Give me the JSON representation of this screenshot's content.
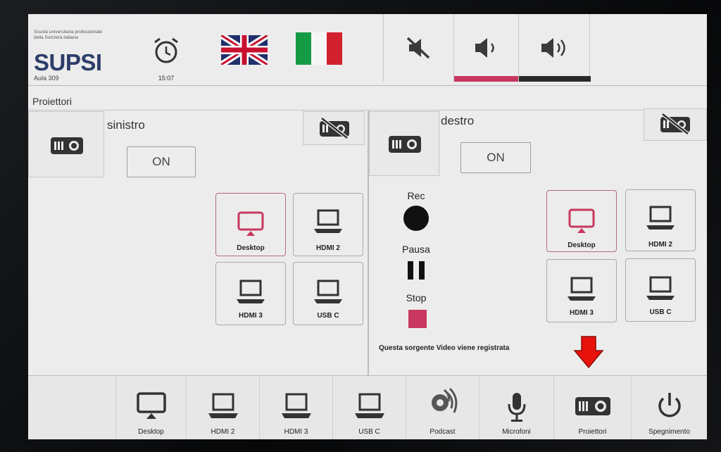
{
  "header": {
    "logo_small_line1": "Scuola universitaria professionale",
    "logo_small_line2": "della Svizzera italiana",
    "logo_main": "SUPSI",
    "room": "Aula 309",
    "time": "15:07"
  },
  "section": {
    "title": "Proiettori"
  },
  "left_panel": {
    "name": "sinistro",
    "on_label": "ON",
    "sources": [
      "Desktop",
      "HDMI 2",
      "HDMI 3",
      "USB C"
    ],
    "active_source": "Desktop"
  },
  "right_panel": {
    "name": "destro",
    "on_label": "ON",
    "rec_label": "Rec",
    "pause_label": "Pausa",
    "stop_label": "Stop",
    "recording_note": "Questa sorgente Video viene registrata",
    "sources": [
      "Desktop",
      "HDMI 2",
      "HDMI 3",
      "USB C"
    ],
    "active_source": "Desktop"
  },
  "bottom_bar": {
    "items": [
      "Desktop",
      "HDMI 2",
      "HDMI 3",
      "USB C",
      "Podcast",
      "Microfoni",
      "Proiettori",
      "Spegnimento"
    ]
  },
  "colors": {
    "accent": "#c8375f",
    "stop": "#c8375f",
    "arrow": "#e8120c",
    "flag_green": "#169b45",
    "flag_red": "#d3202e",
    "uk_blue": "#20306a",
    "uk_red": "#c8102e"
  }
}
